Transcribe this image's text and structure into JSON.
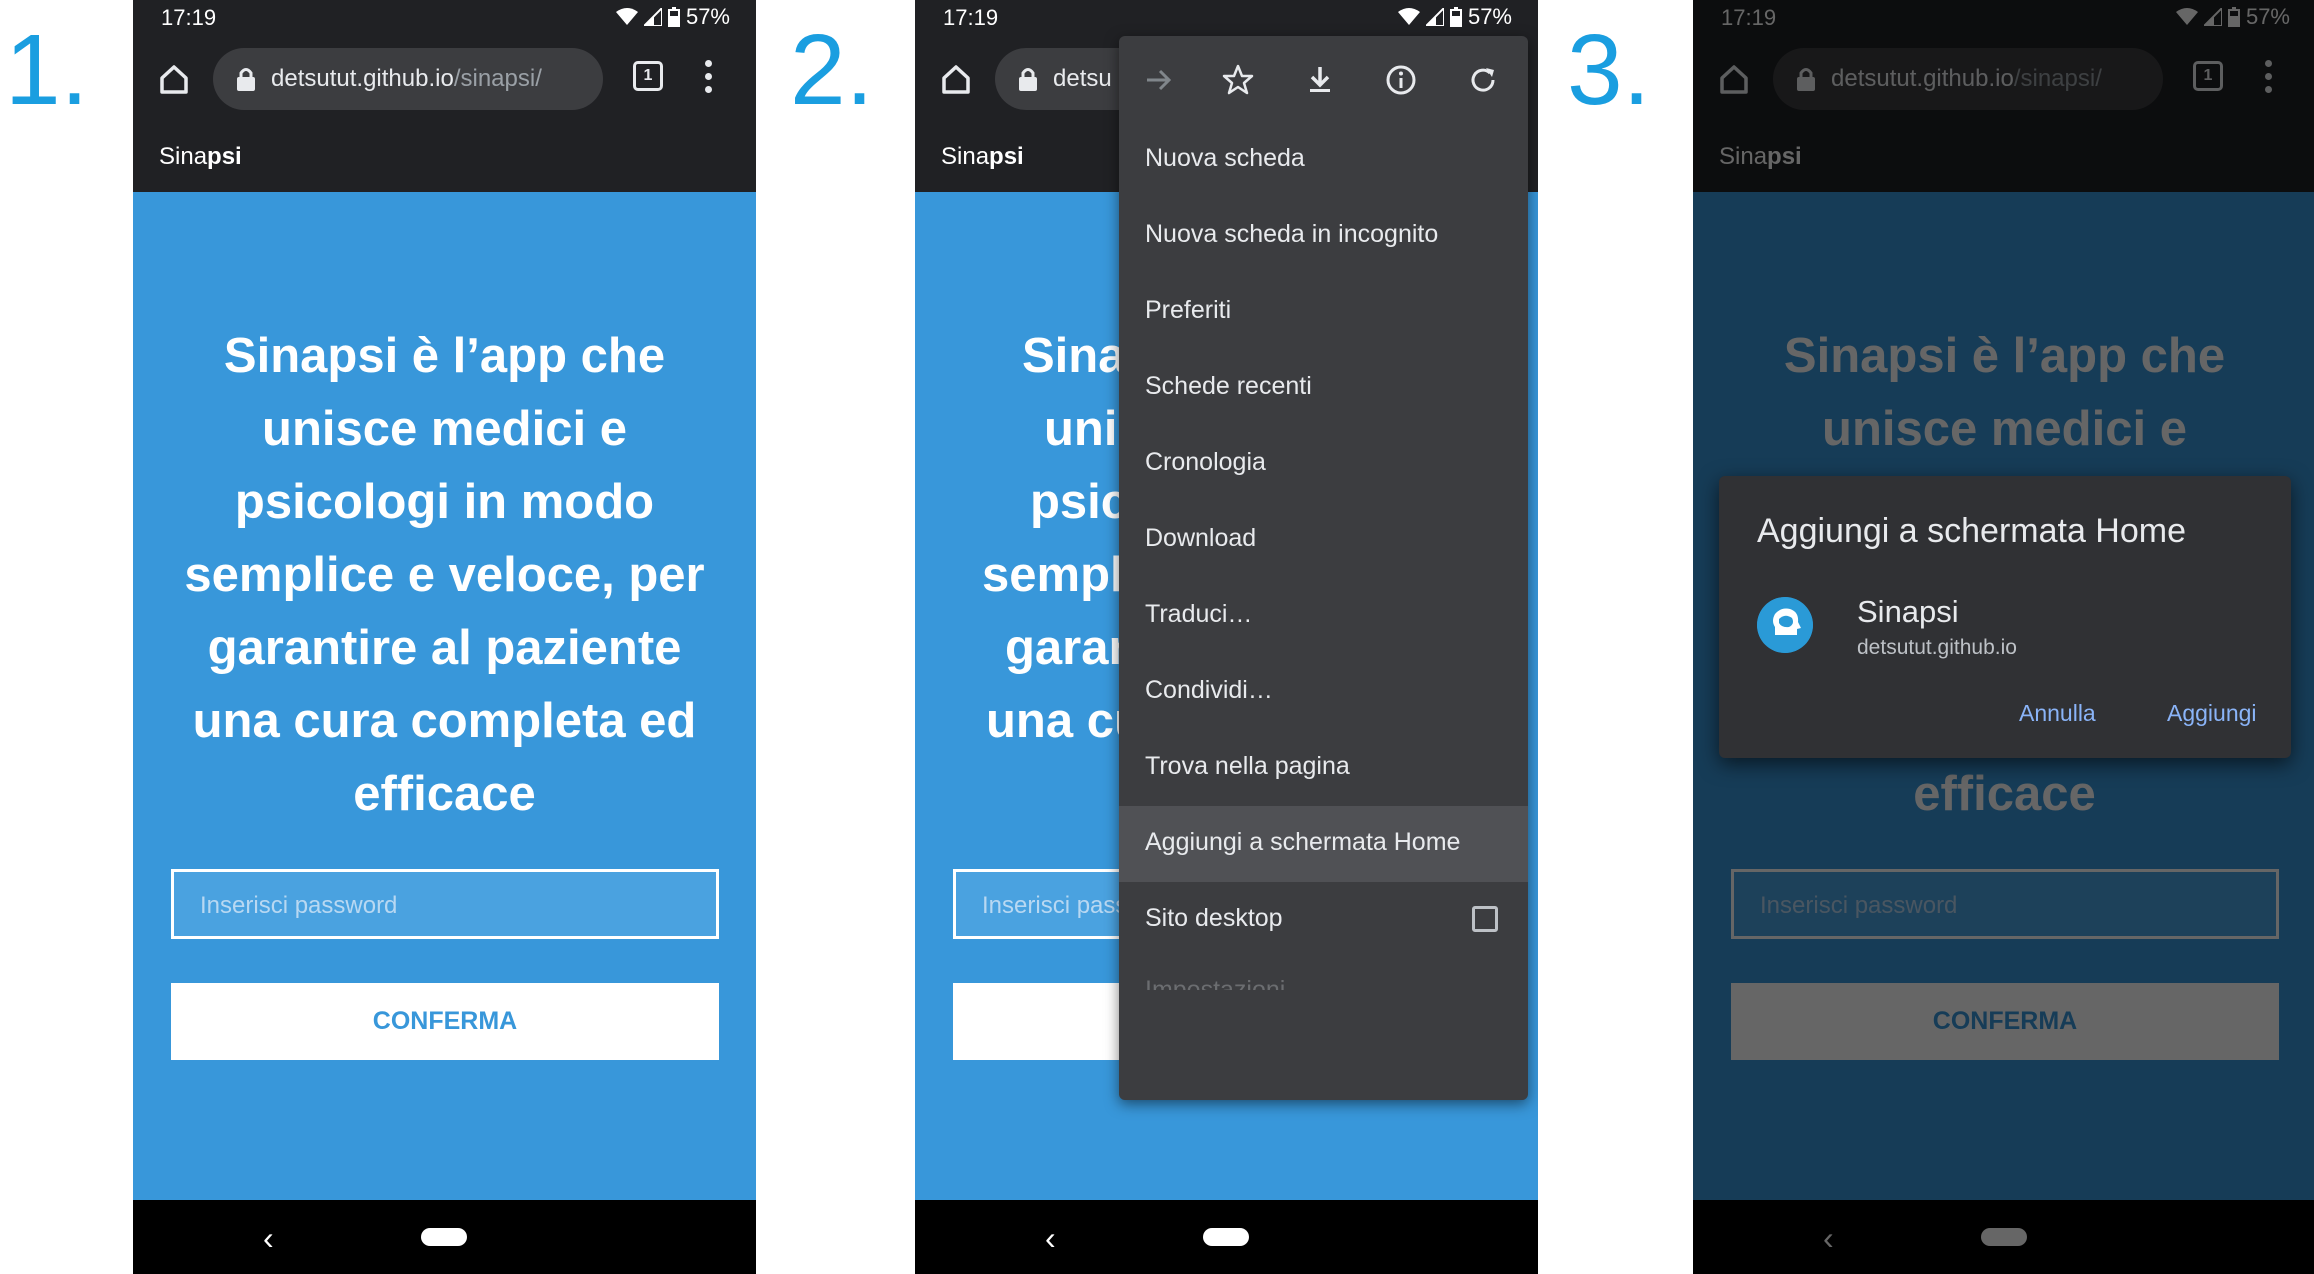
{
  "steps": [
    "1.",
    "2.",
    "3."
  ],
  "status": {
    "time": "17:19",
    "battery": "57%"
  },
  "browser": {
    "url_host": "detsutut.github.io",
    "url_path": "/sinapsi/",
    "url_truncated": "detsu",
    "tab_count": "1"
  },
  "site": {
    "brand_light": "Sina",
    "brand_bold": "psi",
    "headline_lines": [
      "Sinapsi è l’app che",
      "unisce medici e",
      "psicologi in modo",
      "semplice e veloce, per",
      "garantire al paziente",
      "una cura completa ed",
      "efficace"
    ],
    "headline_cut": [
      "Sina",
      "uni",
      "psic",
      "sempli",
      "garan",
      "una cu"
    ],
    "password_placeholder": "Inserisci password",
    "password_cut": "Inserisci pass",
    "confirm_label": "CONFERMA"
  },
  "menu": {
    "icons": [
      "forward-arrow-icon",
      "star-icon",
      "download-icon",
      "info-icon",
      "refresh-icon"
    ],
    "items": [
      "Nuova scheda",
      "Nuova scheda in incognito",
      "Preferiti",
      "Schede recenti",
      "Cronologia",
      "Download",
      "Traduci…",
      "Condividi…",
      "Trova nella pagina",
      "Aggiungi a schermata Home",
      "Sito desktop"
    ],
    "highlighted_index": 9,
    "partial_item": "Impostazioni"
  },
  "dialog": {
    "title": "Aggiungi a schermata Home",
    "app_name": "Sinapsi",
    "app_url": "detsutut.github.io",
    "cancel": "Annulla",
    "add": "Aggiungi"
  },
  "colors": {
    "accent_blue": "#3897da",
    "step_number_blue": "#1a9ee0",
    "chrome_dark": "#202124",
    "menu_bg": "#3c3d40",
    "dialog_link": "#8ab4f8"
  }
}
